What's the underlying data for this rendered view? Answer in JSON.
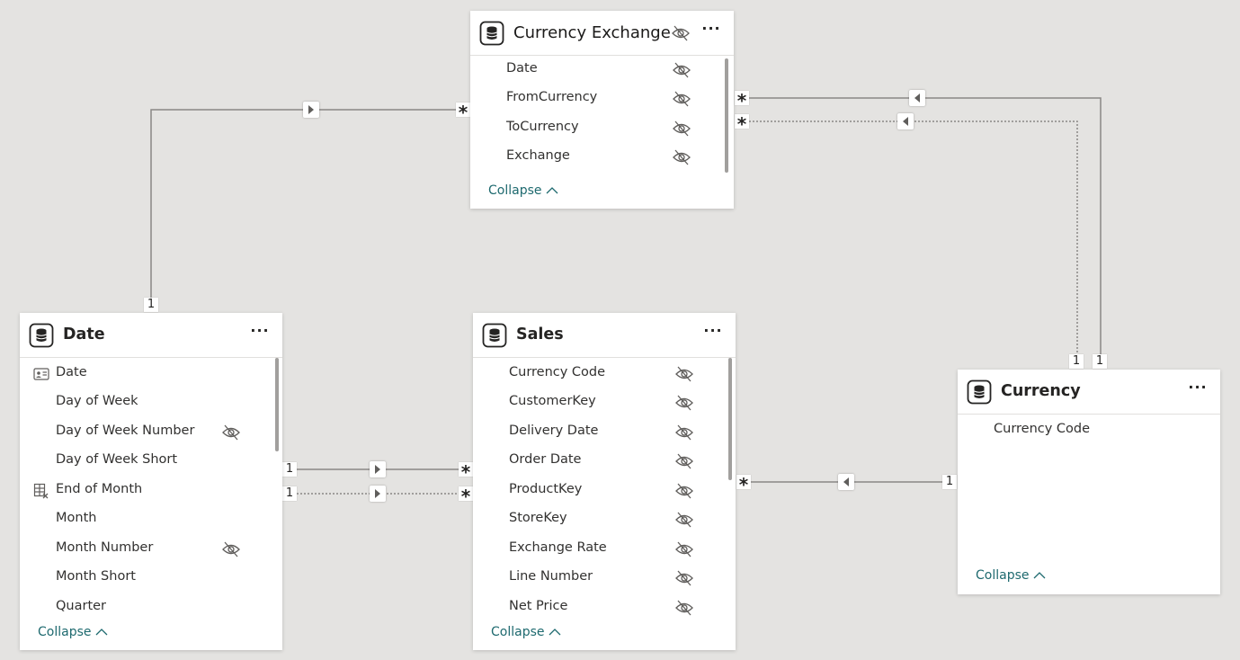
{
  "tables": {
    "currency_exchange": {
      "title": "Currency Exchange",
      "fields": [
        "Date",
        "FromCurrency",
        "ToCurrency",
        "Exchange"
      ],
      "collapse_label": "Collapse"
    },
    "date": {
      "title": "Date",
      "fields": [
        "Date",
        "Day of Week",
        "Day of Week Number",
        "Day of Week Short",
        "End of Month",
        "Month",
        "Month Number",
        "Month Short",
        "Quarter"
      ],
      "collapse_label": "Collapse"
    },
    "sales": {
      "title": "Sales",
      "fields": [
        "Currency Code",
        "CustomerKey",
        "Delivery Date",
        "Order Date",
        "ProductKey",
        "StoreKey",
        "Exchange Rate",
        "Line Number",
        "Net Price"
      ],
      "collapse_label": "Collapse"
    },
    "currency": {
      "title": "Currency",
      "fields": [
        "Currency Code"
      ],
      "collapse_label": "Collapse"
    }
  },
  "cardinality": {
    "one": "1",
    "many": "*"
  },
  "colors": {
    "canvas": "#e4e3e1",
    "line": "#8a8886",
    "link": "#1e6a6f"
  },
  "icons": {
    "table": "table-icon",
    "hidden": "eye-off-icon",
    "more": "more-options-icon",
    "key": "id-card-icon",
    "calc": "calculated-column-icon",
    "collapse": "chevron-up-icon"
  }
}
